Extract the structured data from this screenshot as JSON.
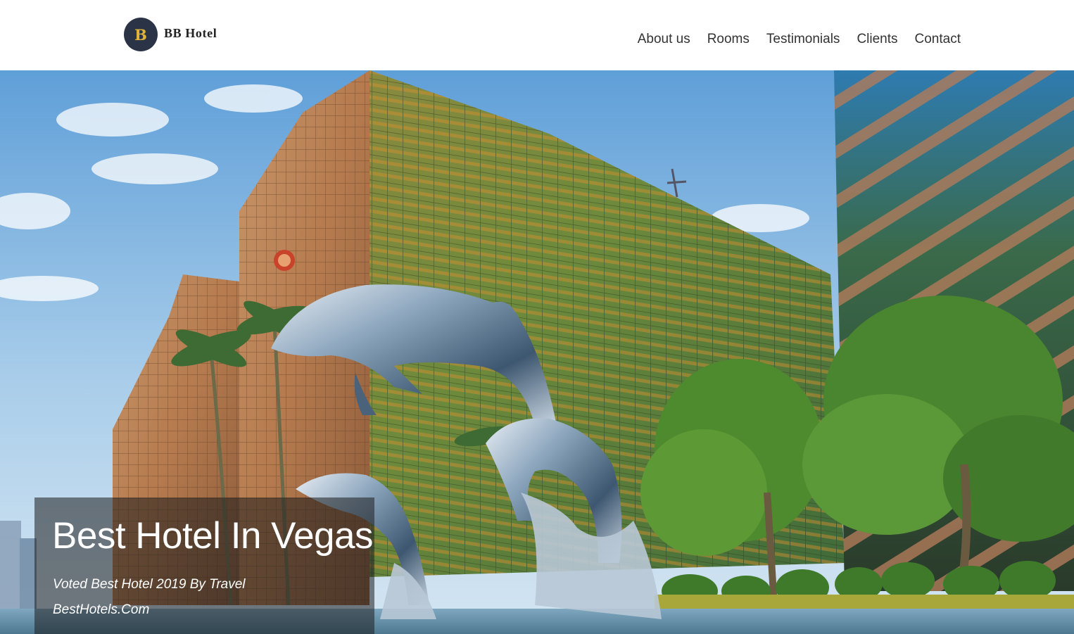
{
  "brand": {
    "badge_letter": "B",
    "name": "BB Hotel",
    "badge_color": "#2b3446",
    "letter_color": "#e0b43a"
  },
  "nav": {
    "items": [
      {
        "label": "About us"
      },
      {
        "label": "Rooms"
      },
      {
        "label": "Testimonials"
      },
      {
        "label": "Clients"
      },
      {
        "label": "Contact"
      }
    ]
  },
  "hero": {
    "image": "hotel-building-with-dolphin-fountain-photo",
    "title": "Best Hotel In Vegas",
    "subtitle": "Voted Best Hotel 2019 By Travel BestHotels.Com"
  }
}
